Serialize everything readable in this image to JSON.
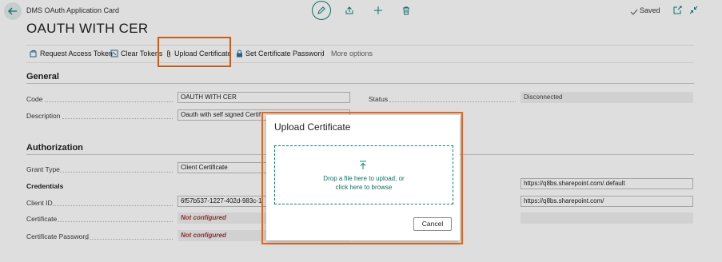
{
  "window": {
    "card_title": "DMS OAuth Application Card",
    "title": "OAUTH WITH CER",
    "status": "Saved"
  },
  "actions": {
    "request_access_token": "Request Access Token",
    "clear_tokens": "Clear Tokens",
    "upload_certificate": "Upload Certificate",
    "set_certificate_password": "Set Certificate Password",
    "more_options": "More options"
  },
  "general": {
    "heading": "General",
    "code_label": "Code",
    "code_value": "OAUTH WITH CER",
    "description_label": "Description",
    "description_value": "Oauth with self signed Certif",
    "status_label": "Status",
    "status_value": "Disconnected"
  },
  "authorization": {
    "heading": "Authorization",
    "grant_type_label": "Grant Type",
    "grant_type_value": "Client Certificate",
    "credentials_label": "Credentials",
    "client_id_label": "Client ID",
    "client_id_value": "6f57b537-1227-402d-983c-1",
    "certificate_label": "Certificate",
    "certificate_value": "Not configured",
    "certificate_password_label": "Certificate Password",
    "certificate_password_value": "Not configured",
    "scope_value": "https://q8bs.sharepoint.com/.default",
    "resource_value": "https://q8bs.sharepoint.com/"
  },
  "dialog": {
    "title": "Upload Certificate",
    "drop_line1": "Drop a file here to upload, or",
    "drop_line2": "click here to browse",
    "cancel_label": "Cancel"
  },
  "colors": {
    "accent": "#0d7f74",
    "highlight": "#e66a1f",
    "error_text": "#a4373a"
  }
}
